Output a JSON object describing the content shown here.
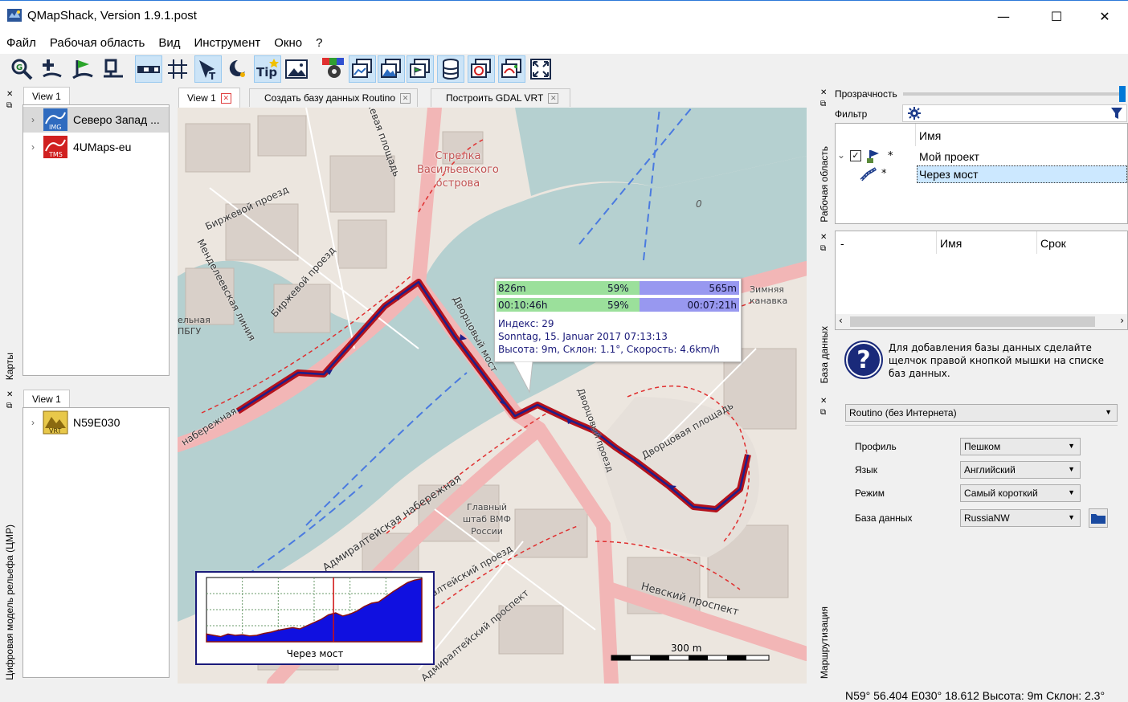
{
  "window": {
    "title": "QMapShack, Version 1.9.1.post",
    "minimize": "—",
    "maximize": "☐",
    "close": "✕"
  },
  "menu": [
    "Файл",
    "Рабочая область",
    "Вид",
    "Инструмент",
    "Окно",
    "?"
  ],
  "left_panels": {
    "maps": {
      "dock_label": "Карты",
      "tab": "View 1",
      "items": [
        {
          "label": "Северо Запад ...",
          "badge": "IMG",
          "badge_color": "#2f6bbf",
          "selected": true
        },
        {
          "label": "4UMaps-eu",
          "badge": "TMS",
          "badge_color": "#d02020",
          "selected": false
        }
      ]
    },
    "dem": {
      "dock_label": "Цифровая модель рельефа (ЦМР)",
      "tab": "View 1",
      "items": [
        {
          "label": "N59E030",
          "badge": "VRT",
          "badge_color": "#b08a18"
        }
      ]
    }
  },
  "center_tabs": [
    {
      "label": "View 1",
      "active": true
    },
    {
      "label": "Создать базу данных Routino",
      "active": false
    },
    {
      "label": "Построить GDAL VRT",
      "active": false
    }
  ],
  "map": {
    "labels": {
      "strelka": [
        "Стрелка",
        "Васильевского",
        "острова"
      ],
      "birzh_ploshad": "Биржевая площадь",
      "birzh_proezd": "Биржевой проезд",
      "birzh_proezd2": "Биржевой проезд",
      "mendeleev": "Менделеевская линия",
      "dvorcovy": "Дворцовый мост",
      "nab": "набережная",
      "admir_nab": "Адмиралтейская набережная",
      "admir_proezd": "Адмиралтейский проезд",
      "admir_prosp": "Адмиралтейский проспект",
      "nevsky": "Невский проспект",
      "dvorc_pl": "Дворцовая площадь",
      "zimnyaya": [
        "Зимняя",
        "канавка"
      ],
      "glavny": [
        "Главный",
        "штаб ВМФ",
        "России"
      ],
      "spbgu": [
        "ельная",
        "ПБГУ"
      ],
      "dvorc_proezd": "Дворцовый проезд",
      "zero": "0"
    },
    "popup": {
      "distance_left": "826m",
      "distance_pct": "59%",
      "distance_right": "565m",
      "time_left": "00:10:46h",
      "time_pct": "59%",
      "time_right": "00:07:21h",
      "progress_fraction": 0.59,
      "index": "Индекс: 29",
      "date": "Sonntag, 15. Januar 2017 07:13:13",
      "stats": "Высота: 9m, Склон: 1.1°, Скорость: 4.6km/h"
    },
    "profile": {
      "title": "Через мост",
      "values": [
        0.12,
        0.1,
        0.08,
        0.12,
        0.1,
        0.11,
        0.09,
        0.1,
        0.13,
        0.15,
        0.18,
        0.2,
        0.22,
        0.2,
        0.25,
        0.3,
        0.35,
        0.42,
        0.45,
        0.4,
        0.43,
        0.48,
        0.55,
        0.6,
        0.62,
        0.7,
        0.78,
        0.85,
        0.92,
        0.96,
        0.98
      ],
      "cursor_fraction": 0.59
    },
    "scale": "300 m"
  },
  "right_panels": {
    "workspace": {
      "dock_label": "Рабочая область",
      "transparency": "Прозрачность",
      "filter": "Фильтр",
      "col_name": "Имя",
      "items": [
        {
          "label": "Мой проект",
          "star": "*"
        },
        {
          "label": "Через мост",
          "star": "*"
        }
      ]
    },
    "database": {
      "dock_label": "База данных",
      "cols": [
        "-",
        "Имя",
        "Срок"
      ],
      "help": "Для добавления базы данных сделайте щелчок правой кнопкой мышки на списке баз данных."
    },
    "routing": {
      "dock_label": "Маршрутизация",
      "engine": "Routino (без Интернета)",
      "rows": [
        {
          "label": "Профиль",
          "value": "Пешком"
        },
        {
          "label": "Язык",
          "value": "Английский"
        },
        {
          "label": "Режим",
          "value": "Самый короткий"
        },
        {
          "label": "База данных",
          "value": "RussiaNW"
        }
      ]
    }
  },
  "statusbar": "N59° 56.404 E030° 18.612  Высота: 9m  Склон: 2.3°",
  "colors": {
    "route": "#b5121b",
    "route_inner": "#1f1f8a",
    "water": "#b5d0d0",
    "road": "#f2b6b6",
    "accent": "#0078d7"
  }
}
